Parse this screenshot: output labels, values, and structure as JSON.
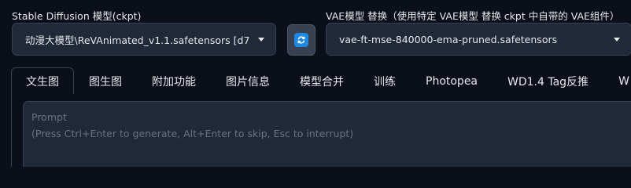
{
  "model_selector": {
    "label": "Stable Diffusion 模型(ckpt)",
    "value": "动漫大模型\\ReVAnimated_v1.1.safetensors [d7"
  },
  "refresh_button": {
    "icon": "refresh-icon",
    "color": "#1e88e5"
  },
  "vae_selector": {
    "label": "VAE模型 替换（使用特定 VAE模型 替换 ckpt 中自带的 VAE组件）",
    "value": "vae-ft-mse-840000-ema-pruned.safetensors"
  },
  "tabs": [
    {
      "label": "文生图"
    },
    {
      "label": "图生图"
    },
    {
      "label": "附加功能"
    },
    {
      "label": "图片信息"
    },
    {
      "label": "模型合并"
    },
    {
      "label": "训练"
    },
    {
      "label": "Photopea"
    },
    {
      "label": "WD1.4 Tag反推"
    },
    {
      "label": "W"
    }
  ],
  "active_tab": "文生图",
  "prompt": {
    "title": "Prompt",
    "placeholder": "(Press Ctrl+Enter to generate, Alt+Enter to skip, Esc to interrupt)"
  }
}
